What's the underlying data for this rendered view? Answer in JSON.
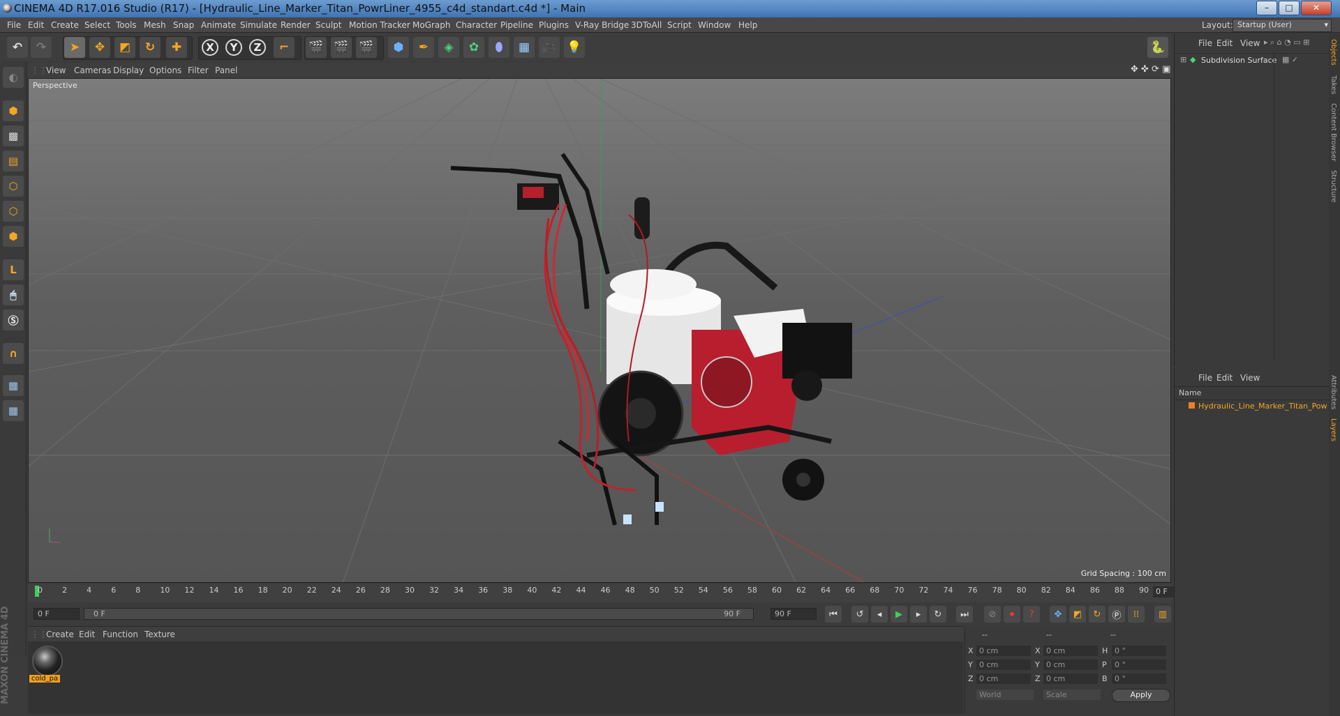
{
  "window": {
    "title": "CINEMA 4D R17.016 Studio (R17) - [Hydraulic_Line_Marker_Titan_PowrLiner_4955_c4d_standart.c4d *] - Main",
    "controls": [
      "–",
      "□",
      "✕"
    ]
  },
  "menubar": {
    "items": [
      "File",
      "Edit",
      "Create",
      "Select",
      "Tools",
      "Mesh",
      "Snap",
      "Animate",
      "Simulate",
      "Render",
      "Sculpt",
      "Motion Tracker",
      "MoGraph",
      "Character",
      "Pipeline",
      "Plugins",
      "V-Ray Bridge",
      "3DToAll",
      "Script",
      "Window",
      "Help"
    ],
    "layout_label": "Layout:",
    "layout_value": "Startup (User)"
  },
  "viewport": {
    "menu": [
      "View",
      "Cameras",
      "Display",
      "Options",
      "Filter",
      "Panel"
    ],
    "label": "Perspective",
    "grid_spacing": "Grid Spacing : 100 cm"
  },
  "timeline": {
    "ticks": [
      "0",
      "2",
      "4",
      "6",
      "8",
      "10",
      "12",
      "14",
      "16",
      "18",
      "20",
      "22",
      "24",
      "26",
      "28",
      "30",
      "32",
      "34",
      "36",
      "38",
      "40",
      "42",
      "44",
      "46",
      "48",
      "50",
      "52",
      "54",
      "56",
      "58",
      "60",
      "62",
      "64",
      "66",
      "68",
      "70",
      "72",
      "74",
      "76",
      "78",
      "80",
      "82",
      "84",
      "86",
      "88",
      "90"
    ],
    "current_frame": "0 F",
    "start_field": "0 F",
    "range_start": "0 F",
    "range_end": "90 F",
    "end_field": "90 F"
  },
  "material_manager": {
    "menu": [
      "Create",
      "Edit",
      "Function",
      "Texture"
    ],
    "materials": [
      {
        "name": "cold_pa"
      }
    ]
  },
  "coordinates": {
    "header": [
      "--",
      "--",
      "--"
    ],
    "rows": [
      {
        "l1": "X",
        "v1": "0 cm",
        "l2": "X",
        "v2": "0 cm",
        "l3": "H",
        "v3": "0 °"
      },
      {
        "l1": "Y",
        "v1": "0 cm",
        "l2": "Y",
        "v2": "0 cm",
        "l3": "P",
        "v3": "0 °"
      },
      {
        "l1": "Z",
        "v1": "0 cm",
        "l2": "Z",
        "v2": "0 cm",
        "l3": "B",
        "v3": "0 °"
      }
    ],
    "mode1": "World",
    "mode2": "Scale",
    "apply": "Apply"
  },
  "object_manager": {
    "menu": [
      "File",
      "Edit",
      "View"
    ],
    "objects": [
      {
        "name": "Subdivision Surface"
      }
    ]
  },
  "layer_manager": {
    "menu": [
      "File",
      "Edit",
      "View"
    ],
    "column": "Name",
    "items": [
      {
        "name": "Hydraulic_Line_Marker_Titan_Pow"
      }
    ]
  },
  "side_tabs": [
    "Objects",
    "Takes",
    "Content Browser",
    "Structure",
    "Attributes",
    "Layers"
  ],
  "brand": "MAXON CINEMA 4D",
  "colors": {
    "accent": "#f0a020",
    "selected_text": "#f5a623",
    "title_bar": "#4f80bd"
  }
}
